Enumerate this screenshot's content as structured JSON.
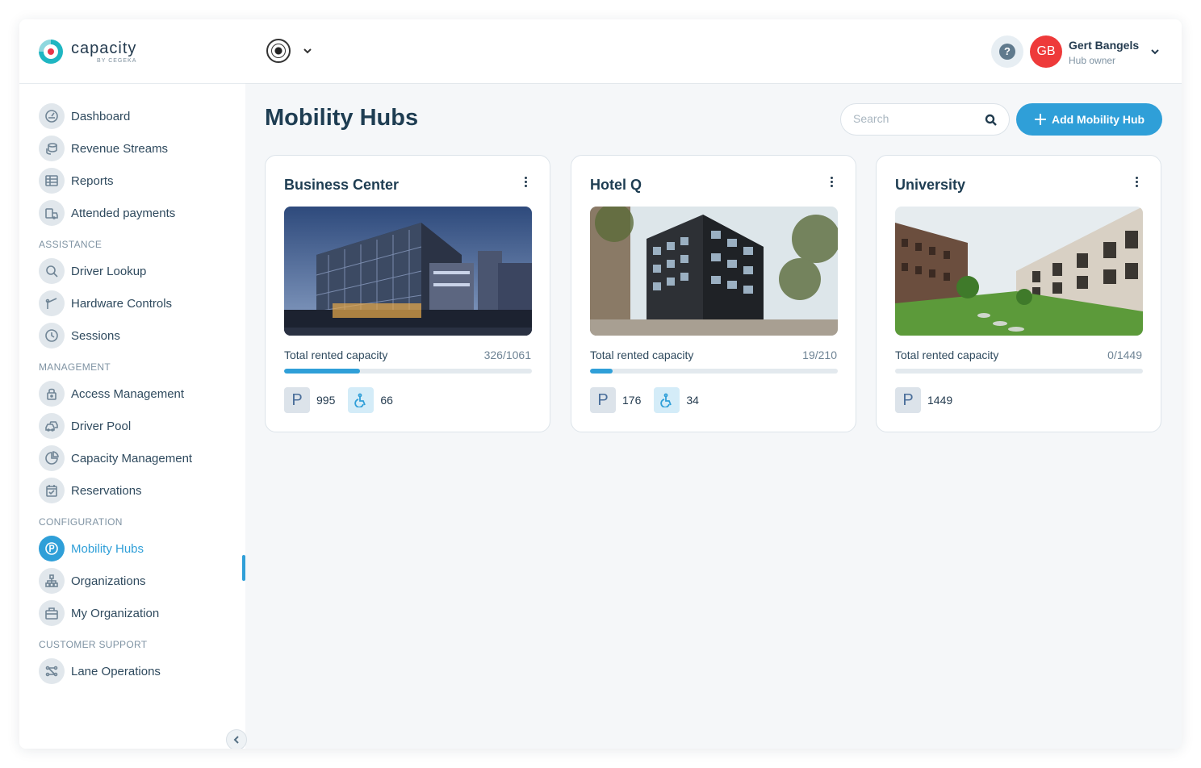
{
  "brand": {
    "name": "capacity",
    "sub": "BY CEGEKA"
  },
  "sidebar": {
    "groups": [
      {
        "title": "",
        "items": [
          {
            "label": "Dashboard",
            "icon": "dashboard-icon"
          },
          {
            "label": "Revenue Streams",
            "icon": "coins-icon"
          },
          {
            "label": "Reports",
            "icon": "table-icon"
          },
          {
            "label": "Attended payments",
            "icon": "attended-payment-icon"
          }
        ]
      },
      {
        "title": "ASSISTANCE",
        "items": [
          {
            "label": "Driver Lookup",
            "icon": "search-icon"
          },
          {
            "label": "Hardware Controls",
            "icon": "barrier-icon"
          },
          {
            "label": "Sessions",
            "icon": "clock-icon"
          }
        ]
      },
      {
        "title": "MANAGEMENT",
        "items": [
          {
            "label": "Access Management",
            "icon": "lock-icon"
          },
          {
            "label": "Driver Pool",
            "icon": "cars-icon"
          },
          {
            "label": "Capacity Management",
            "icon": "pie-chart-icon"
          },
          {
            "label": "Reservations",
            "icon": "calendar-check-icon"
          }
        ]
      },
      {
        "title": "CONFIGURATION",
        "items": [
          {
            "label": "Mobility Hubs",
            "icon": "parking-icon",
            "active": true
          },
          {
            "label": "Organizations",
            "icon": "org-chart-icon"
          },
          {
            "label": "My Organization",
            "icon": "briefcase-icon"
          }
        ]
      },
      {
        "title": "CUSTOMER SUPPORT",
        "items": [
          {
            "label": "Lane Operations",
            "icon": "lanes-icon"
          }
        ]
      }
    ]
  },
  "topbar": {
    "help_label": "?",
    "user": {
      "initials": "GB",
      "name": "Gert Bangels",
      "role": "Hub owner",
      "avatar_color": "#ee3a3a"
    }
  },
  "main": {
    "title": "Mobility Hubs",
    "search_placeholder": "Search",
    "add_button_label": "Add Mobility Hub",
    "accent_color": "#2f9fd8"
  },
  "hubs": [
    {
      "name": "Business Center",
      "capacity_label": "Total rented capacity",
      "rented": 326,
      "total": 1061,
      "capacity_text": "326/1061",
      "parking": "995",
      "accessible": "66",
      "image": "office-building-photo"
    },
    {
      "name": "Hotel Q",
      "capacity_label": "Total rented capacity",
      "rented": 19,
      "total": 210,
      "capacity_text": "19/210",
      "parking": "176",
      "accessible": "34",
      "image": "hotel-building-photo"
    },
    {
      "name": "University",
      "capacity_label": "Total rented capacity",
      "rented": 0,
      "total": 1449,
      "capacity_text": "0/1449",
      "parking": "1449",
      "accessible": null,
      "image": "university-campus-photo"
    }
  ]
}
